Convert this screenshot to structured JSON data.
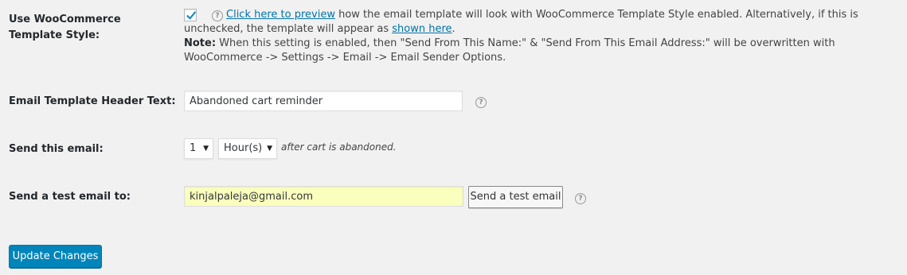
{
  "template_style": {
    "label": "Use WooCommerce Template Style:",
    "checked": true,
    "preview_link": "Click here to preview",
    "desc_part1": " how the email template will look with WooCommerce Template Style enabled. Alternatively, if this is unchecked, the template will appear as ",
    "shown_link": "shown here",
    "desc_part2": ".",
    "note_label": "Note:",
    "note_text": " When this setting is enabled, then \"Send From This Name:\" & \"Send From This Email Address:\" will be overwritten with WooCommerce -> Settings -> Email -> Email Sender Options."
  },
  "header_text": {
    "label": "Email Template Header Text:",
    "value": "Abandoned cart reminder"
  },
  "send_email": {
    "label": "Send this email:",
    "number_value": "1",
    "unit_value": "Hour(s)",
    "after_text": "after cart is abandoned."
  },
  "test_email": {
    "label": "Send a test email to:",
    "value": "kinjalpaleja@gmail.com",
    "button_label": "Send a test email"
  },
  "help_icon_glyph": "?",
  "update_button_label": "Update Changes",
  "colors": {
    "link": "#0073aa",
    "primary": "#0085ba",
    "autofill": "#faffbd"
  }
}
